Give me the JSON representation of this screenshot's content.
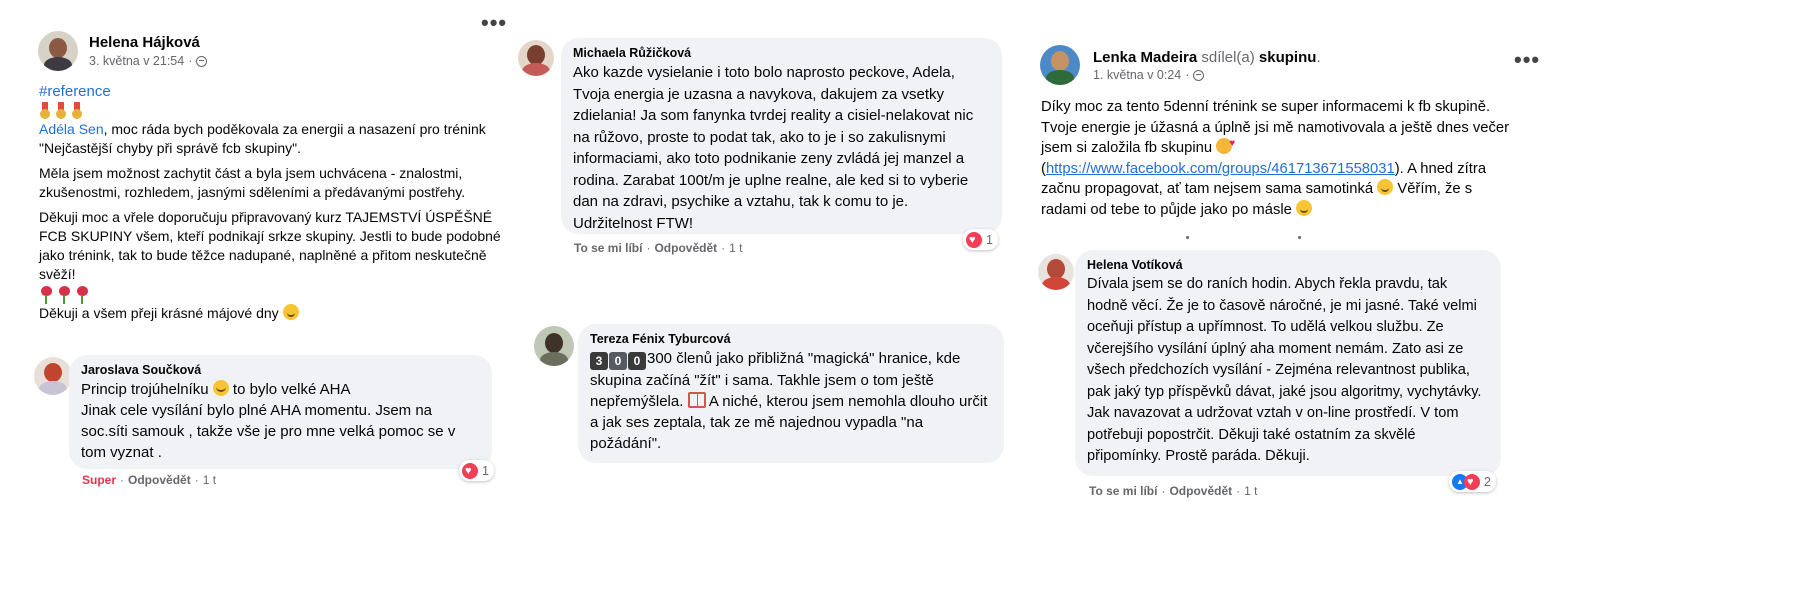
{
  "post1": {
    "author": "Helena Hájková",
    "date": "3. května v 21:54",
    "more_label": "•••",
    "hashtag": "#reference",
    "mention": "Adéla Sen",
    "intro": ", moc ráda bych poděkovala za energii a nasazení pro trénink \"Nejčastější chyby při správě fcb skupiny\".",
    "paragraph2": "Měla jsem možnost zachytit část a byla jsem uchvácena - znalostmi, zkušenostmi, rozhledem, jasnými sděleními a předávanými postřehy.",
    "paragraph3": "Děkuji moc a vřele doporučuju připravovaný kurz TAJEMSTVÍ ÚSPĚŠNÉ FCB SKUPINY všem, kteří podnikají srkze skupiny. Jestli to bude podobné jako trénink, tak to bude těžce nadupané, naplněné a přitom neskutečně svěží!",
    "closing": "Děkuji a všem přeji krásné májové dny",
    "comment": {
      "author": "Jaroslava Součková",
      "line1a": "Princip trojúhelníku",
      "line1b": "to bylo velké AHA",
      "rest": "Jinak cele vysílání bylo plné AHA momentu. Jsem na soc.síti samouk , takže vše je pro mne velká pomoc se v tom vyznat .",
      "reaction_label": "Super",
      "reply_label": "Odpovědět",
      "time": "1 t",
      "reaction_count": "1"
    }
  },
  "post2": {
    "comment1": {
      "author": "Michaela Růžičková",
      "text": "Ako kazde vysielanie i toto bolo naprosto peckove, Adela, Tvoja energia je uzasna a navykova, dakujem za vsetky zdielania! Ja som fanynka tvrdej reality a cisiel-nelakovat nic na růžovo, proste to podat tak, ako to je i so zakulisnymi informaciami, ako toto podnikanie zeny zvládá jej manzel a rodina. Zarabat 100t/m je uplne realne, ale ked si to vyberie dan na zdravi, psychike a vztahu, tak k comu to je. Udržitelnost FTW!",
      "like_label": "To se mi líbí",
      "reply_label": "Odpovědět",
      "time": "1 t",
      "reaction_count": "1"
    },
    "comment2": {
      "author": "Tereza Fénix Tyburcová",
      "keys": [
        "3",
        "0",
        "0"
      ],
      "text_a": "300 členů jako přibližná \"magická\" hranice, kde skupina začíná \"žít\" i sama. Takhle jsem o tom ještě nepřemýšlela.",
      "text_b": "A niché, kterou jsem nemohla dlouho určit a jak ses zeptala, tak ze mě najednou vypadla \"na požádání\"."
    }
  },
  "post3": {
    "author": "Lenka Madeira",
    "shared_text": "sdílel(a)",
    "group_label": "skupinu",
    "date": "1. května v 0:24",
    "more_label": "•••",
    "text_a": "Díky moc za tento 5denní trénink se super informacemi k fb skupině. Tvoje energie je úžasná a úplně jsi mě namotivovala a ještě dnes večer jsem si založila fb skupinu",
    "link": "https://www.facebook.com/groups/461713671558031",
    "text_b": ". A hned zítra začnu propagovat, ať tam nejsem sama samotinká",
    "text_c": "Věřím, že s radami od tebe to půjde jako po másle",
    "comment": {
      "author": "Helena Votíková",
      "text": "Dívala jsem se do raních hodin. Abych řekla pravdu, tak hodně věcí. Že je to časově náročné, je mi jasné. Také velmi oceňuji přístup a upřímnost. To udělá velkou službu. Ze včerejšího vysílání úplný aha moment nemám. Zato asi ze všech předchozích vysílání - Zejména relevantnost publika, pak jaký typ příspěvků dávat, jaké jsou algoritmy, vychytávky. Jak navazovat a udržovat vztah v on-line prostředí. V tom potřebuji popostrčit. Děkuji také ostatním za skvělé připomínky. Prostě paráda. Děkuji.",
      "like_label": "To se mi líbí",
      "reply_label": "Odpovědět",
      "time": "1 t",
      "reaction_count": "2"
    }
  }
}
